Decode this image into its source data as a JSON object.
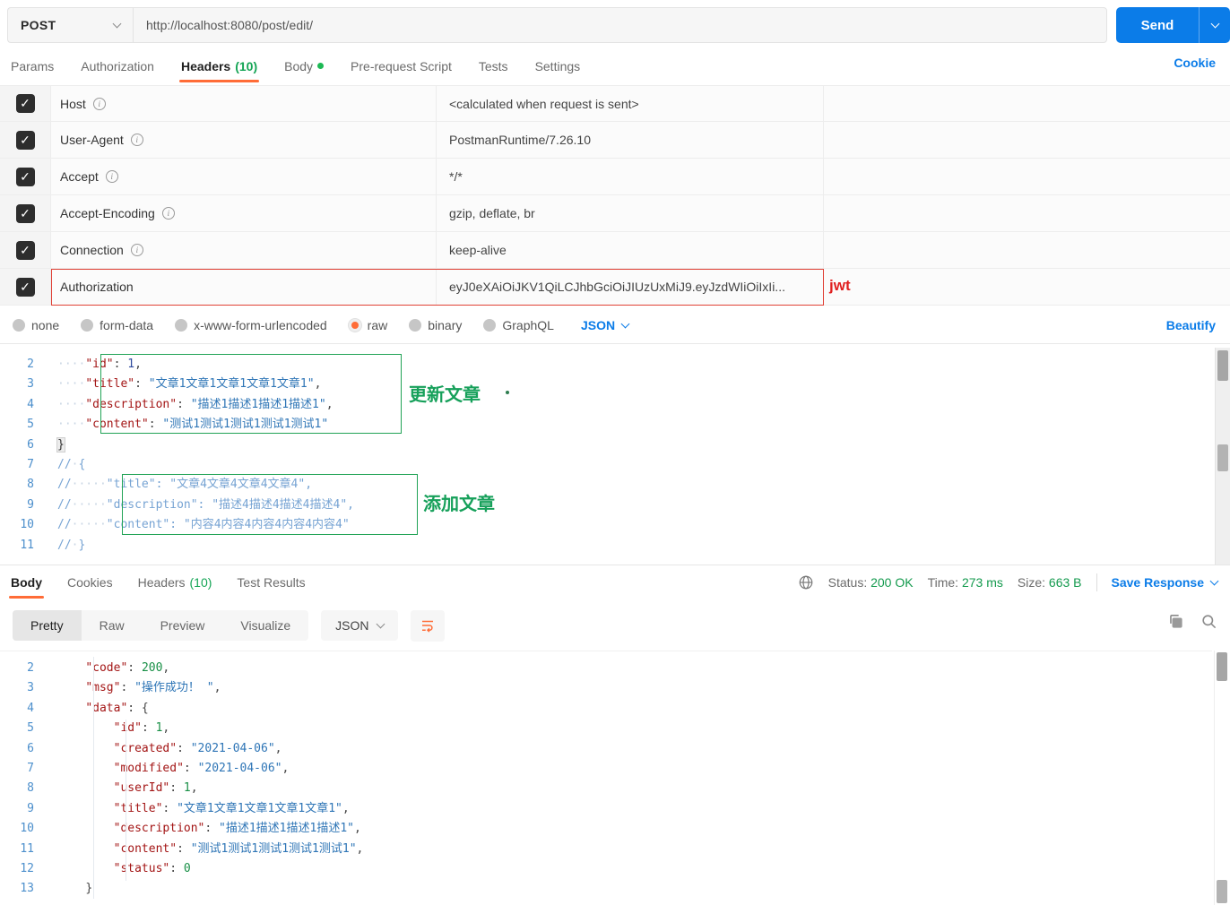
{
  "colors": {
    "accent_orange": "#FF6C37",
    "link_blue": "#0B7CE8",
    "success_green": "#149A4E",
    "error_red": "#E01F1F",
    "send_blue": "#0B7CE8"
  },
  "topbar": {
    "method": "POST",
    "url": "http://localhost:8080/post/edit/",
    "send": "Send"
  },
  "request_tabs": {
    "items": [
      {
        "label": "Params"
      },
      {
        "label": "Authorization"
      },
      {
        "label": "Headers",
        "count": "(10)"
      },
      {
        "label": "Body"
      },
      {
        "label": "Pre-request Script"
      },
      {
        "label": "Tests"
      },
      {
        "label": "Settings"
      }
    ],
    "cookie": "Cookie"
  },
  "headers_table": {
    "rows": [
      {
        "key": "Host",
        "value": "<calculated when request is sent>"
      },
      {
        "key": "User-Agent",
        "value": "PostmanRuntime/7.26.10"
      },
      {
        "key": "Accept",
        "value": "*/*"
      },
      {
        "key": "Accept-Encoding",
        "value": "gzip, deflate, br"
      },
      {
        "key": "Connection",
        "value": "keep-alive"
      },
      {
        "key": "Authorization",
        "value": "eyJ0eXAiOiJKV1QiLCJhbGciOiJIUzUxMiJ9.eyJzdWIiOiIxIi...",
        "annotation": "jwt"
      }
    ]
  },
  "body_type": {
    "options": [
      "none",
      "form-data",
      "x-www-form-urlencoded",
      "raw",
      "binary",
      "GraphQL"
    ],
    "selected": "raw",
    "language": "JSON",
    "beautify": "Beautify"
  },
  "request_editor": {
    "annotations": {
      "update": "更新文章",
      "add": "添加文章"
    },
    "lines": [
      {
        "n": 2,
        "t": [
          [
            "w",
            "····"
          ],
          [
            "k",
            "\"id\""
          ],
          [
            "p",
            ": "
          ],
          [
            "b",
            "1"
          ],
          [
            "p",
            ","
          ]
        ]
      },
      {
        "n": 3,
        "t": [
          [
            "w",
            "····"
          ],
          [
            "k",
            "\"title\""
          ],
          [
            "p",
            ": "
          ],
          [
            "s",
            "\"文章1文章1文章1文章1文章1\""
          ],
          [
            "p",
            ","
          ]
        ]
      },
      {
        "n": 4,
        "t": [
          [
            "w",
            "····"
          ],
          [
            "k",
            "\"description\""
          ],
          [
            "p",
            ": "
          ],
          [
            "s",
            "\"描述1描述1描述1描述1\""
          ],
          [
            "p",
            ","
          ]
        ]
      },
      {
        "n": 5,
        "t": [
          [
            "w",
            "····"
          ],
          [
            "k",
            "\"content\""
          ],
          [
            "p",
            ": "
          ],
          [
            "s",
            "\"测试1测试1测试1测试1测试1\""
          ]
        ]
      },
      {
        "n": 6,
        "t": [
          [
            "h",
            "}"
          ]
        ]
      },
      {
        "n": 7,
        "t": [
          [
            "c",
            "//"
          ],
          [
            "w",
            "·"
          ],
          [
            "c",
            "{"
          ]
        ]
      },
      {
        "n": 8,
        "t": [
          [
            "c",
            "//"
          ],
          [
            "w",
            "·····"
          ],
          [
            "c",
            "\"title\": \"文章4文章4文章4文章4\","
          ]
        ]
      },
      {
        "n": 9,
        "t": [
          [
            "c",
            "//"
          ],
          [
            "w",
            "·····"
          ],
          [
            "c",
            "\"description\": \"描述4描述4描述4描述4\","
          ]
        ]
      },
      {
        "n": 10,
        "t": [
          [
            "c",
            "//"
          ],
          [
            "w",
            "·····"
          ],
          [
            "c",
            "\"content\": \"内容4内容4内容4内容4内容4\""
          ]
        ]
      },
      {
        "n": 11,
        "t": [
          [
            "c",
            "//"
          ],
          [
            "w",
            "·"
          ],
          [
            "c",
            "}"
          ]
        ]
      }
    ]
  },
  "response_tabs": {
    "items": [
      {
        "label": "Body"
      },
      {
        "label": "Cookies"
      },
      {
        "label": "Headers",
        "count": "(10)"
      },
      {
        "label": "Test Results"
      }
    ]
  },
  "response_meta": {
    "status_label": "Status:",
    "status_value": "200 OK",
    "time_label": "Time:",
    "time_value": "273 ms",
    "size_label": "Size:",
    "size_value": "663 B",
    "save": "Save Response"
  },
  "response_view": {
    "modes": [
      "Pretty",
      "Raw",
      "Preview",
      "Visualize"
    ],
    "active": "Pretty",
    "language": "JSON"
  },
  "response_editor": {
    "lines": [
      {
        "n": 2,
        "t": [
          [
            "w",
            "    "
          ],
          [
            "k",
            "\"code\""
          ],
          [
            "p",
            ": "
          ],
          [
            "n",
            "200"
          ],
          [
            "p",
            ","
          ]
        ]
      },
      {
        "n": 3,
        "t": [
          [
            "w",
            "    "
          ],
          [
            "k",
            "\"msg\""
          ],
          [
            "p",
            ": "
          ],
          [
            "s",
            "\"操作成功！ \""
          ],
          [
            "p",
            ","
          ]
        ]
      },
      {
        "n": 4,
        "t": [
          [
            "w",
            "    "
          ],
          [
            "k",
            "\"data\""
          ],
          [
            "p",
            ": {"
          ]
        ]
      },
      {
        "n": 5,
        "t": [
          [
            "w",
            "        "
          ],
          [
            "k",
            "\"id\""
          ],
          [
            "p",
            ": "
          ],
          [
            "n",
            "1"
          ],
          [
            "p",
            ","
          ]
        ]
      },
      {
        "n": 6,
        "t": [
          [
            "w",
            "        "
          ],
          [
            "k",
            "\"created\""
          ],
          [
            "p",
            ": "
          ],
          [
            "s",
            "\"2021-04-06\""
          ],
          [
            "p",
            ","
          ]
        ]
      },
      {
        "n": 7,
        "t": [
          [
            "w",
            "        "
          ],
          [
            "k",
            "\"modified\""
          ],
          [
            "p",
            ": "
          ],
          [
            "s",
            "\"2021-04-06\""
          ],
          [
            "p",
            ","
          ]
        ]
      },
      {
        "n": 8,
        "t": [
          [
            "w",
            "        "
          ],
          [
            "k",
            "\"userId\""
          ],
          [
            "p",
            ": "
          ],
          [
            "n",
            "1"
          ],
          [
            "p",
            ","
          ]
        ]
      },
      {
        "n": 9,
        "t": [
          [
            "w",
            "        "
          ],
          [
            "k",
            "\"title\""
          ],
          [
            "p",
            ": "
          ],
          [
            "s",
            "\"文章1文章1文章1文章1文章1\""
          ],
          [
            "p",
            ","
          ]
        ]
      },
      {
        "n": 10,
        "t": [
          [
            "w",
            "        "
          ],
          [
            "k",
            "\"description\""
          ],
          [
            "p",
            ": "
          ],
          [
            "s",
            "\"描述1描述1描述1描述1\""
          ],
          [
            "p",
            ","
          ]
        ]
      },
      {
        "n": 11,
        "t": [
          [
            "w",
            "        "
          ],
          [
            "k",
            "\"content\""
          ],
          [
            "p",
            ": "
          ],
          [
            "s",
            "\"测试1测试1测试1测试1测试1\""
          ],
          [
            "p",
            ","
          ]
        ]
      },
      {
        "n": 12,
        "t": [
          [
            "w",
            "        "
          ],
          [
            "k",
            "\"status\""
          ],
          [
            "p",
            ": "
          ],
          [
            "n",
            "0"
          ]
        ]
      },
      {
        "n": 13,
        "t": [
          [
            "w",
            "    "
          ],
          [
            "p",
            "}"
          ]
        ]
      }
    ]
  }
}
